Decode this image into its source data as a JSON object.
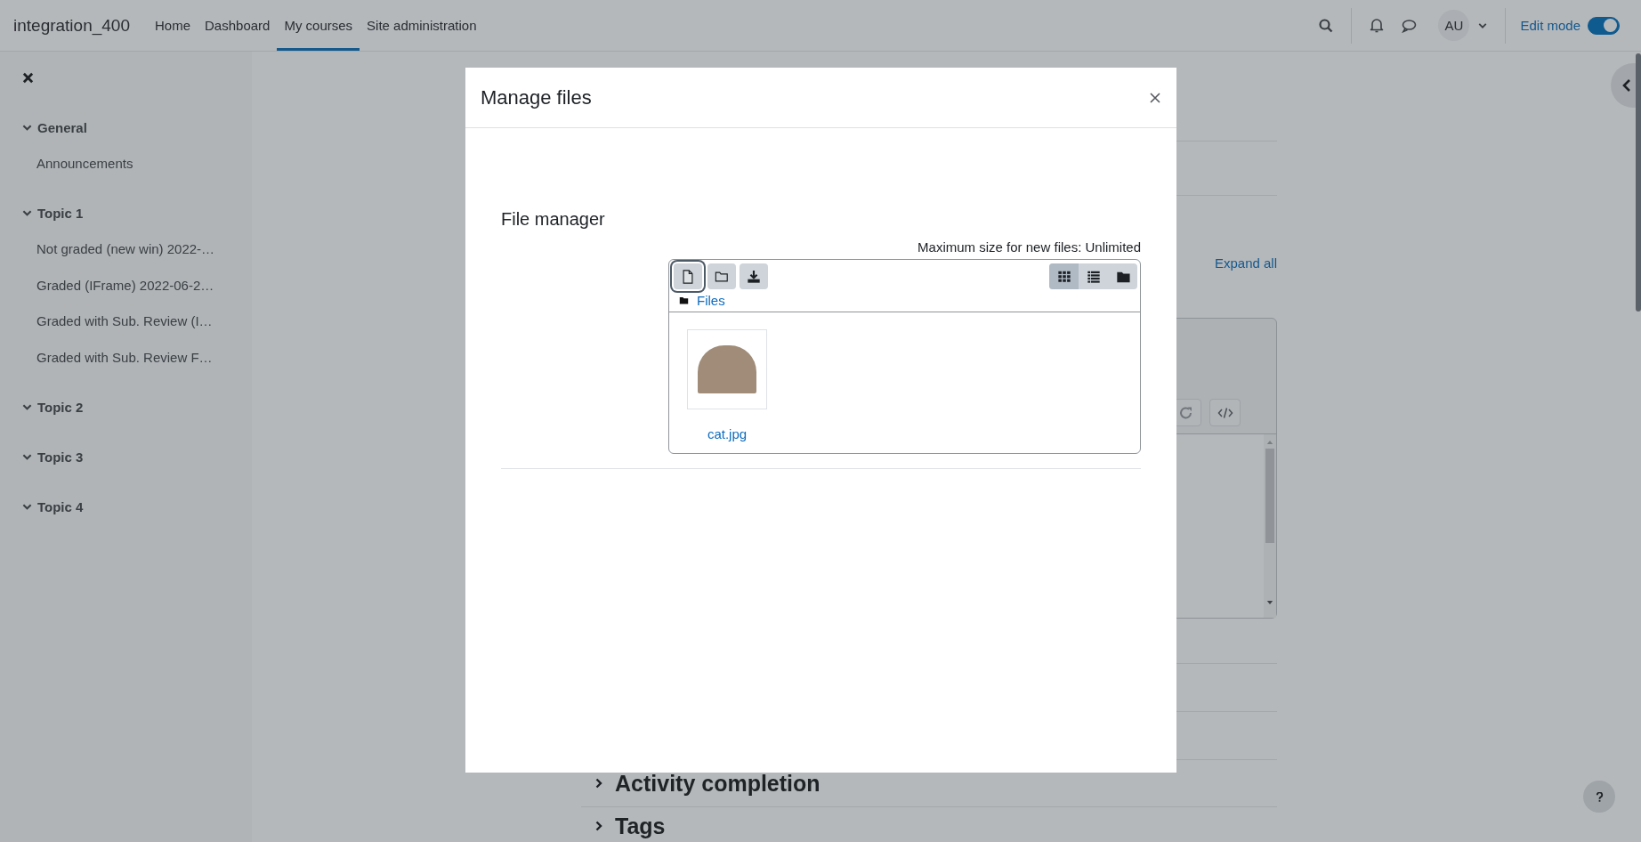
{
  "navbar": {
    "site_name": "integration_400",
    "links": [
      {
        "label": "Home",
        "selected": false
      },
      {
        "label": "Dashboard",
        "selected": false
      },
      {
        "label": "My courses",
        "selected": true
      },
      {
        "label": "Site administration",
        "selected": false
      }
    ],
    "avatar_initials": "AU",
    "edit_mode": {
      "label": "Edit mode",
      "on": true
    }
  },
  "course_index": {
    "sections": [
      {
        "title": "General",
        "expanded": true,
        "items": [
          "Announcements"
        ]
      },
      {
        "title": "Topic 1",
        "expanded": true,
        "items": [
          "Not graded (new win) 2022-…",
          "Graded (IFrame) 2022-06-2…",
          "Graded with Sub. Review (I…",
          "Graded with Sub. Review F…"
        ]
      },
      {
        "title": "Topic 2",
        "expanded": true
      },
      {
        "title": "Topic 3",
        "expanded": true
      },
      {
        "title": "Topic 4",
        "expanded": true
      }
    ]
  },
  "page": {
    "expand_all": "Expand all",
    "sections": [
      {
        "title": "Activity completion",
        "expanded": false
      },
      {
        "title": "Tags",
        "expanded": false
      }
    ]
  },
  "dialog": {
    "title": "Manage files",
    "heading": "File manager",
    "max_size_note": "Maximum size for new files: Unlimited",
    "actions": [
      {
        "kind": "add-file",
        "focused": true
      },
      {
        "kind": "new-folder",
        "focused": false
      },
      {
        "kind": "download",
        "focused": false
      }
    ],
    "view_modes": [
      {
        "kind": "icons",
        "selected": true
      },
      {
        "kind": "list",
        "selected": false
      },
      {
        "kind": "tree",
        "selected": false
      }
    ],
    "breadcrumb": "Files",
    "files": [
      {
        "name": "cat.jpg"
      }
    ]
  }
}
